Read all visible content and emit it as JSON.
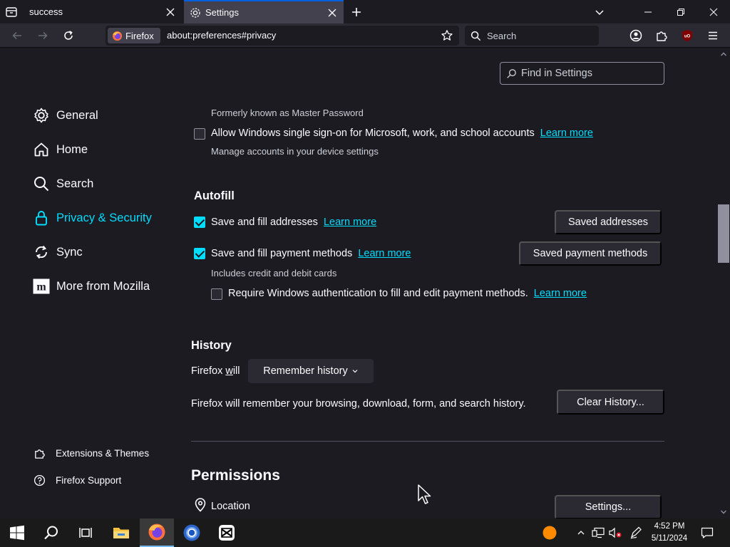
{
  "tabs": [
    {
      "title": "success"
    },
    {
      "title": "Settings"
    }
  ],
  "navbar": {
    "identity_label": "Firefox",
    "url": "about:preferences#privacy",
    "search_placeholder": "Search"
  },
  "find": {
    "placeholder": "Find in Settings"
  },
  "sidebar": {
    "items": [
      {
        "label": "General",
        "icon": "gear-icon"
      },
      {
        "label": "Home",
        "icon": "home-icon"
      },
      {
        "label": "Search",
        "icon": "search-icon"
      },
      {
        "label": "Privacy & Security",
        "icon": "lock-icon"
      },
      {
        "label": "Sync",
        "icon": "sync-icon"
      },
      {
        "label": "More from Mozilla",
        "icon": "mozilla-icon"
      }
    ],
    "footer": [
      {
        "label": "Extensions & Themes",
        "icon": "puzzle-icon"
      },
      {
        "label": "Firefox Support",
        "icon": "help-icon"
      }
    ]
  },
  "main": {
    "formerly": "Formerly known as Master Password",
    "sso": {
      "label": "Allow Windows single sign-on for Microsoft, work, and school accounts",
      "link": "Learn more",
      "desc": "Manage accounts in your device settings",
      "checked": false
    },
    "autofill": {
      "heading": "Autofill",
      "addresses": {
        "label": "Save and fill addresses",
        "link": "Learn more",
        "button": "Saved addresses",
        "checked": true
      },
      "payments": {
        "label": "Save and fill payment methods",
        "link": "Learn more",
        "button": "Saved payment methods",
        "desc": "Includes credit and debit cards",
        "checked": true
      },
      "require_auth": {
        "label": "Require Windows authentication to fill and edit payment methods.",
        "link": "Learn more",
        "checked": false
      }
    },
    "history": {
      "heading": "History",
      "will_label_pre": "Firefox ",
      "will_label_u": "w",
      "will_label_post": "ill",
      "select_value": "Remember history",
      "desc": "Firefox will remember your browsing, download, form, and search history.",
      "clear_button": "Clear History..."
    },
    "permissions": {
      "heading": "Permissions",
      "location": {
        "label": "Location",
        "button": "Settings..."
      }
    }
  },
  "taskbar": {
    "time": "4:52 PM",
    "date": "5/11/2024"
  },
  "colors": {
    "accent": "#00ddff",
    "tab_accent": "#0060df",
    "background": "#1c1b22"
  }
}
